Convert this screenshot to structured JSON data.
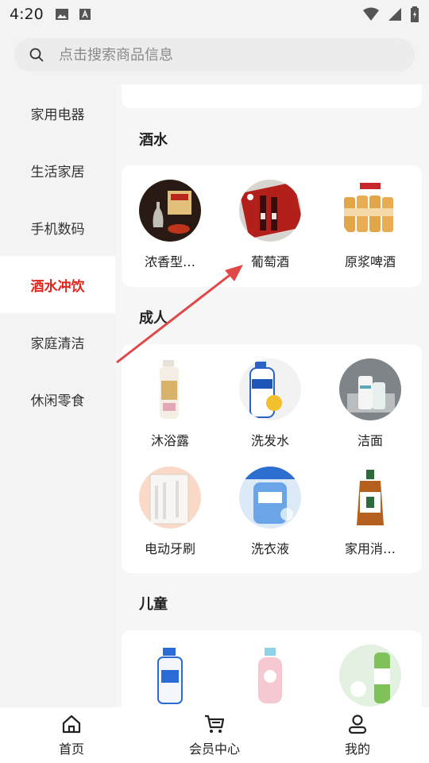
{
  "status_bar": {
    "time": "4:20"
  },
  "search": {
    "placeholder": "点击搜索商品信息"
  },
  "sidebar": {
    "items": [
      {
        "label": "家用电器"
      },
      {
        "label": "生活家居"
      },
      {
        "label": "手机数码"
      },
      {
        "label": "酒水冲饮",
        "active": true
      },
      {
        "label": "家庭清洁"
      },
      {
        "label": "休闲零食"
      }
    ]
  },
  "sections": [
    {
      "title": "酒水",
      "items": [
        {
          "label": "浓香型…"
        },
        {
          "label": "葡萄酒"
        },
        {
          "label": "原浆啤酒"
        }
      ]
    },
    {
      "title": "成人",
      "items": [
        {
          "label": "沐浴露"
        },
        {
          "label": "洗发水"
        },
        {
          "label": "洁面"
        },
        {
          "label": "电动牙刷"
        },
        {
          "label": "洗衣液"
        },
        {
          "label": "家用消…"
        }
      ]
    },
    {
      "title": "儿童",
      "items": []
    }
  ],
  "bottom_nav": {
    "items": [
      {
        "label": "首页",
        "icon": "home-icon"
      },
      {
        "label": "会员中心",
        "icon": "cart-icon"
      },
      {
        "label": "我的",
        "icon": "user-icon"
      }
    ]
  },
  "colors": {
    "accent": "#e2231a",
    "arrow": "#e04848"
  }
}
